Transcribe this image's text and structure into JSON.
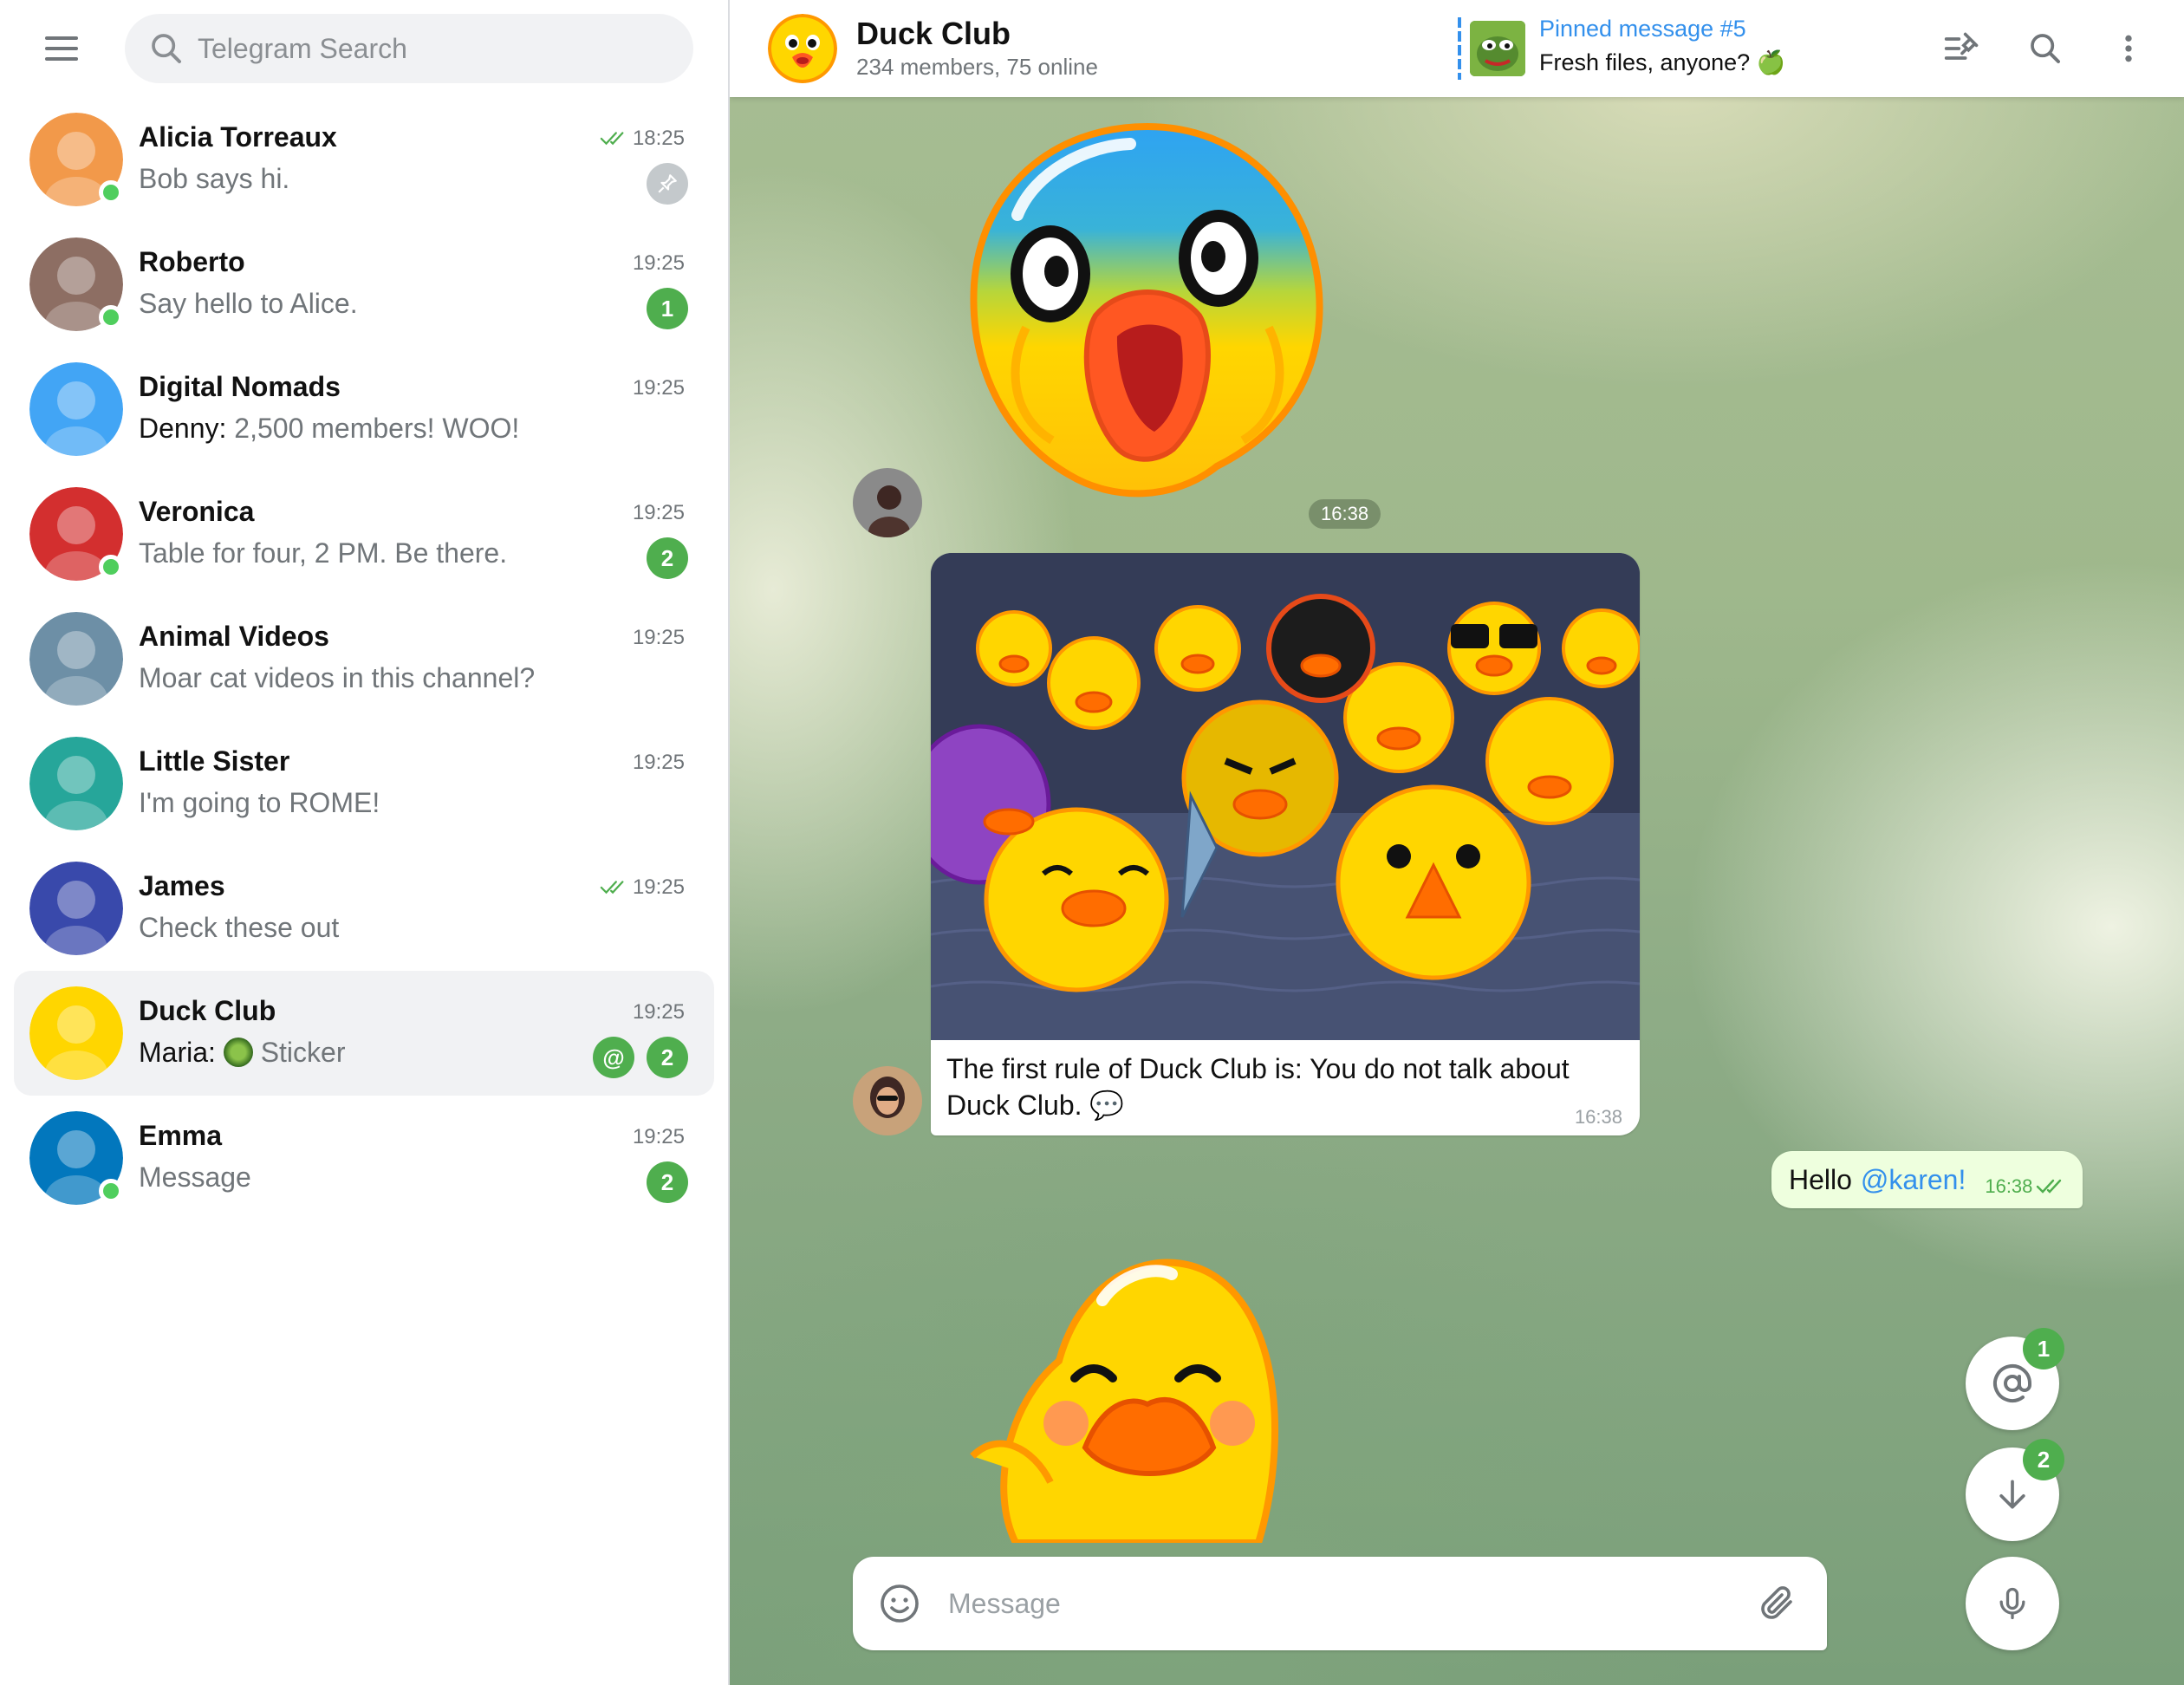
{
  "search": {
    "placeholder": "Telegram Search"
  },
  "chats": [
    {
      "title": "Alicia Torreaux",
      "time": "18:25",
      "preview": "Bob says hi.",
      "read": true,
      "pinned": true,
      "online": true,
      "avatar_color": "#f2994a"
    },
    {
      "title": "Roberto",
      "time": "19:25",
      "preview": "Say hello to Alice.",
      "unread": "1",
      "online": true,
      "avatar_color": "#8d6e63"
    },
    {
      "title": "Digital Nomads",
      "time": "19:25",
      "sender": "Denny:",
      "preview": "2,500 members! WOO!",
      "avatar_color": "#42a5f5"
    },
    {
      "title": "Veronica",
      "time": "19:25",
      "preview": "Table for four, 2 PM. Be there.",
      "unread": "2",
      "online": true,
      "avatar_color": "#d32f2f"
    },
    {
      "title": "Animal Videos",
      "time": "19:25",
      "preview": "Moar cat videos in this channel?",
      "avatar_color": "#6d8fa6"
    },
    {
      "title": "Little Sister",
      "time": "19:25",
      "preview": "I'm going to ROME!",
      "avatar_color": "#26a69a"
    },
    {
      "title": "James",
      "time": "19:25",
      "preview": "Check these out",
      "read": true,
      "avatar_color": "#3949ab"
    },
    {
      "title": "Duck Club",
      "time": "19:25",
      "sender": "Maria:",
      "preview": "Sticker",
      "mention": "@",
      "unread": "2",
      "active": true,
      "avatar_color": "#ffd600"
    },
    {
      "title": "Emma",
      "time": "19:25",
      "preview": "Message",
      "unread": "2",
      "online": true,
      "avatar_color": "#0277bd"
    }
  ],
  "header": {
    "title": "Duck Club",
    "subtitle": "234 members, 75 online",
    "pinned_title": "Pinned message #5",
    "pinned_text": "Fresh files, anyone? 🍏"
  },
  "messages": {
    "sticker_time": "16:38",
    "photo_caption": "The first rule of Duck Club is: You do not talk about Duck Club. 💬",
    "photo_time": "16:38",
    "outgoing_text": "Hello",
    "outgoing_mention": "@karen!",
    "outgoing_time": "16:38"
  },
  "fabs": {
    "mentions_count": "1",
    "unread_count": "2"
  },
  "composer": {
    "placeholder": "Message"
  },
  "colors": {
    "accent": "#3390ec",
    "green": "#4fae4e",
    "online": "#4fce5d",
    "outgoing_bubble": "#eeffde"
  }
}
